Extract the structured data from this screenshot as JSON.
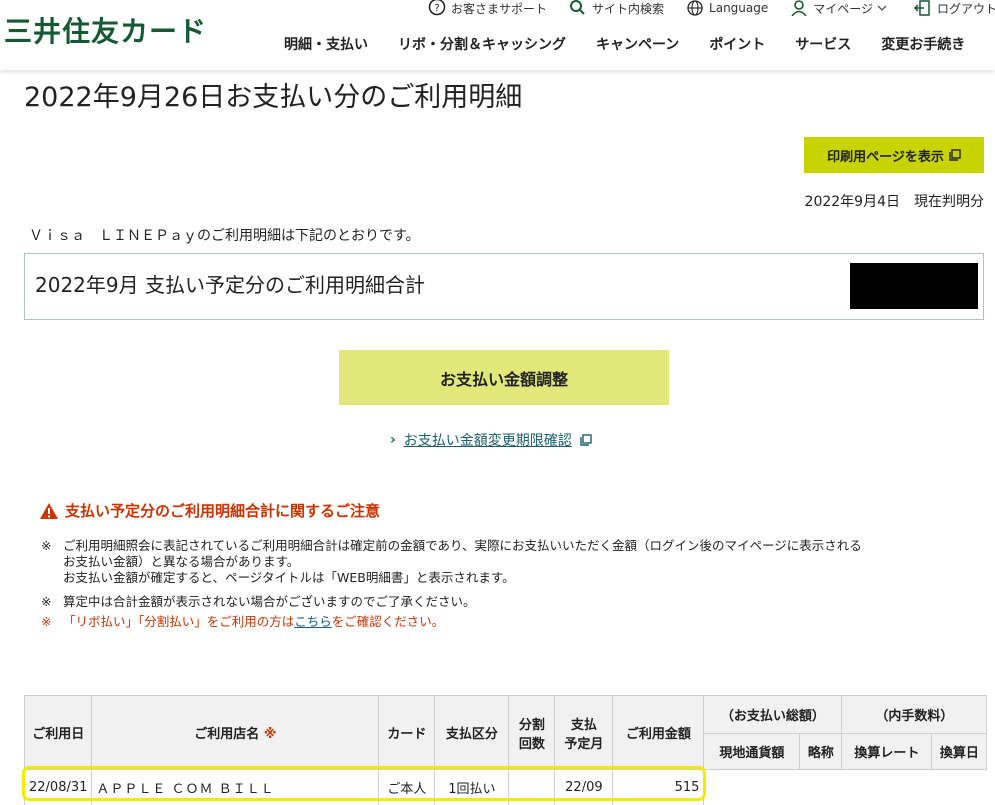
{
  "header": {
    "logo": "三井住友カード",
    "util": [
      "お客さまサポート",
      "サイト内検索",
      "Language",
      "マイページ",
      "ログアウト"
    ],
    "gnav": [
      "明細・支払い",
      "リボ・分割＆キャッシング",
      "キャンペーン",
      "ポイント",
      "サービス",
      "変更お手続き"
    ]
  },
  "page": {
    "title": "2022年9月26日お支払い分のご利用明細",
    "print_button": "印刷用ページを表示",
    "as_of": "2022年9月4日　現在判明分",
    "intro": "Ｖｉｓａ　ＬＩＮＥＰａｙのご利用明細は下記のとおりです。",
    "total_label": "2022年9月 支払い予定分のご利用明細合計",
    "adjust_button": "お支払い金額調整",
    "limit_link": "お支払い金額変更期限確認"
  },
  "notice": {
    "title": "支払い予定分のご利用明細合計に関するご注意",
    "mark": "※",
    "lines1": [
      "ご利用明細照会に表記されているご利用明細合計は確定前の金額であり、実際にお支払いいただく金額（ログイン後のマイページに表示される",
      "お支払い金額）と異なる場合があります。",
      "お支払い金額が確定すると、ページタイトルは「WEB明細書」と表示されます。"
    ],
    "line2": "算定中は合計金額が表示されない場合がございますのでご了承ください。",
    "line3_before": "「リボ払い」「分割払い」をご利用の方は",
    "line3_link": "こちら",
    "line3_after": "をご確認ください。"
  },
  "table": {
    "headers": {
      "date": "ご利用日",
      "store": "ご利用店名",
      "store_mark": "※",
      "card": "カード",
      "pay_type": "支払区分",
      "installments_1": "分割",
      "installments_2": "回数",
      "month_1": "支払",
      "month_2": "予定月",
      "amount": "ご利用金額",
      "total_group": "（お支払い総額）",
      "local_amount": "現地通貨額",
      "abbr": "略称",
      "fee_group": "（内手数料）",
      "rate": "換算レート",
      "conv_date": "換算日"
    },
    "rows": [
      {
        "date": "22/08/31",
        "store": "ＡＰＰＬＥ ＣＯＭ ＢＩＬＬ",
        "card": "ご本人",
        "pay_type": "1回払い",
        "installments": "",
        "month": "22/09",
        "amount": "515"
      }
    ]
  }
}
